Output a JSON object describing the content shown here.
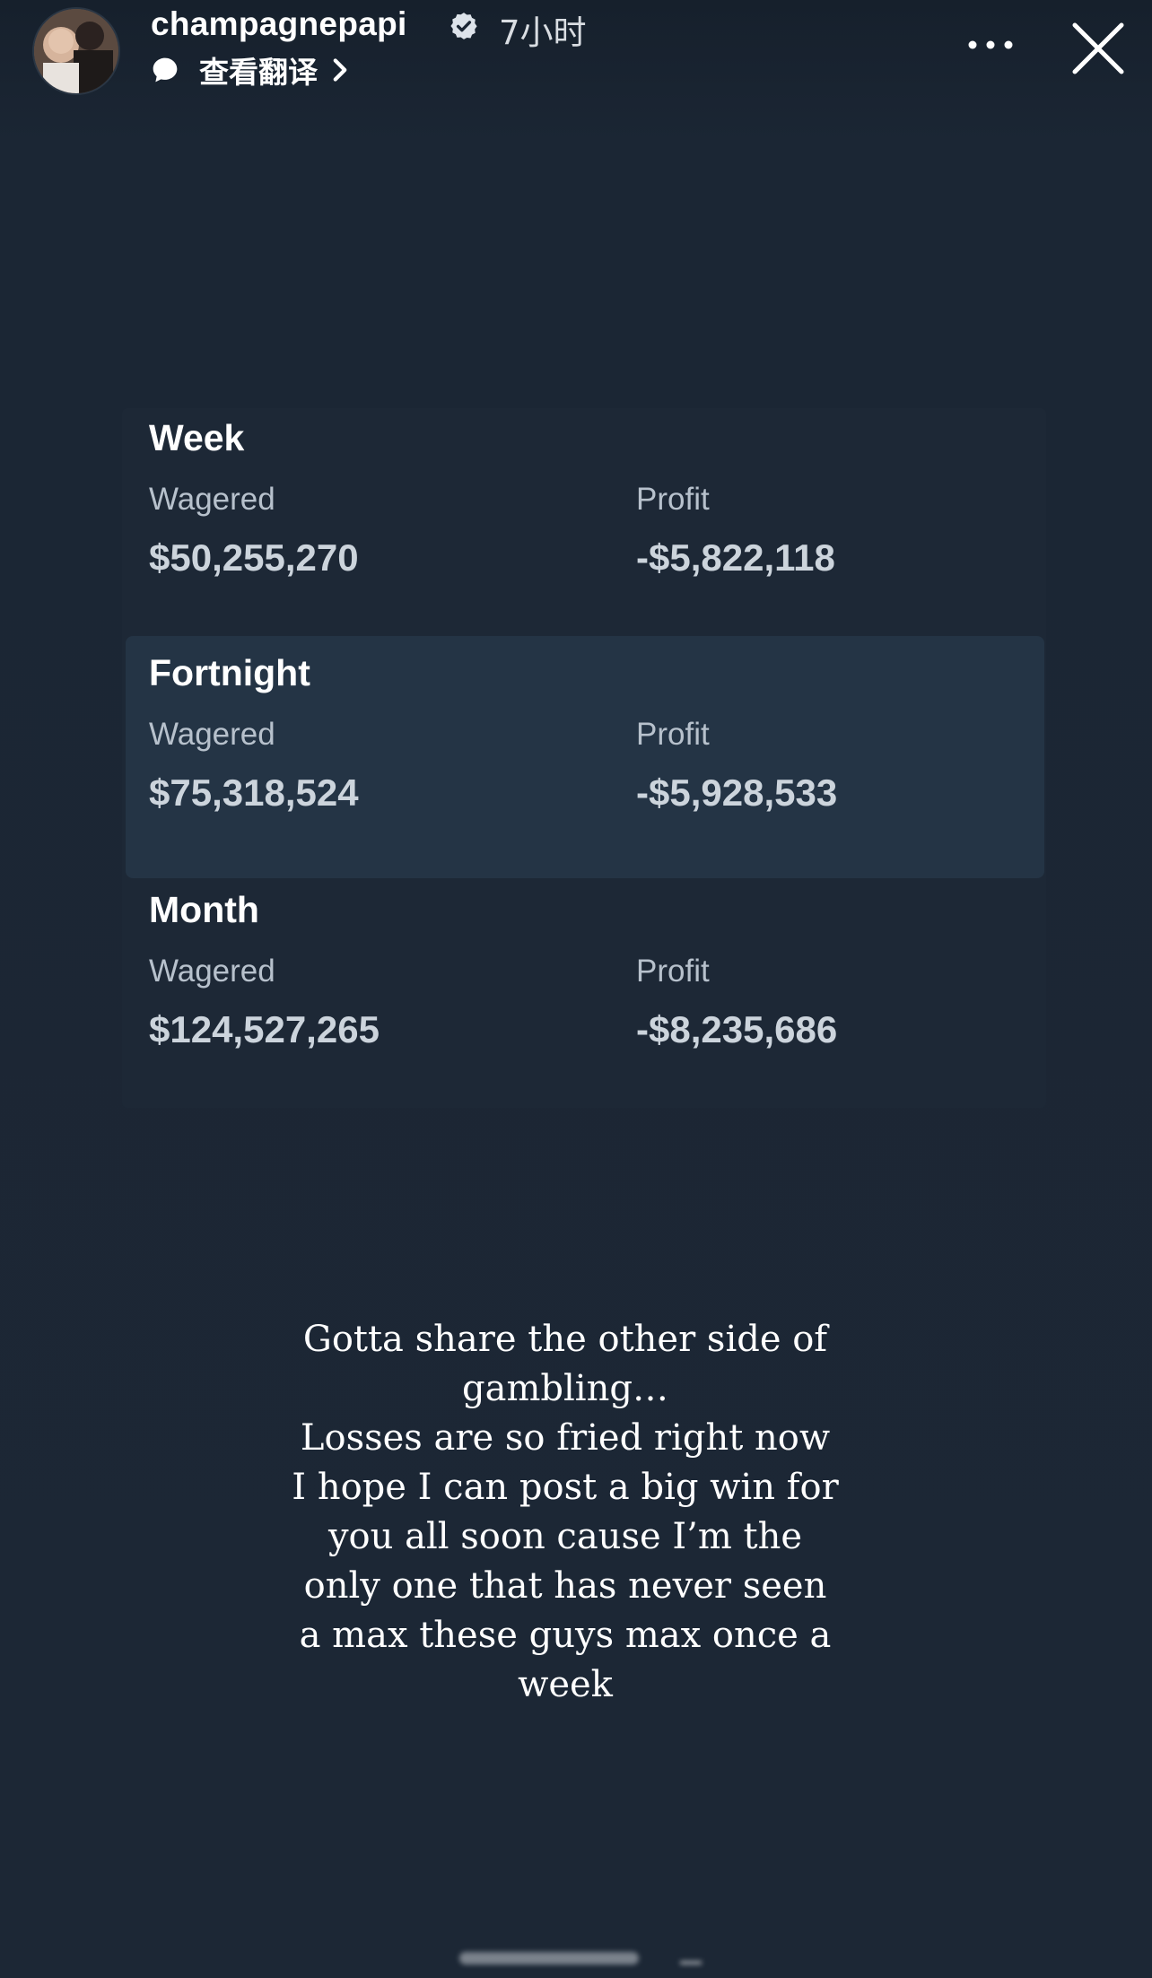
{
  "header": {
    "username": "champagnepapi",
    "time": "7小时",
    "translate_label": "查看翻译",
    "icons": {
      "avatar": "profile-photo",
      "verified": "verified-badge-icon",
      "translate": "chat-bubble-icon",
      "chevron": "chevron-right-icon",
      "more": "more-horizontal-icon",
      "close": "close-icon"
    }
  },
  "stats": [
    {
      "period": "Week",
      "wagered_label": "Wagered",
      "wagered": "$50,255,270",
      "profit_label": "Profit",
      "profit": "-$5,822,118",
      "highlighted": false
    },
    {
      "period": "Fortnight",
      "wagered_label": "Wagered",
      "wagered": "$75,318,524",
      "profit_label": "Profit",
      "profit": "-$5,928,533",
      "highlighted": true
    },
    {
      "period": "Month",
      "wagered_label": "Wagered",
      "wagered": "$124,527,265",
      "profit_label": "Profit",
      "profit": "-$8,235,686",
      "highlighted": false
    }
  ],
  "caption": {
    "lines": [
      "Gotta share the other side of",
      "gambling…",
      "Losses are so fried right now",
      "I hope I can post a big win for",
      "you all soon cause I’m the",
      "only one that has never seen",
      "a max these guys max once a",
      "week"
    ]
  },
  "colors": {
    "background": "#1b2634",
    "highlight_row": "#243445",
    "text_primary": "#ffffff",
    "text_label": "#b7c1cc"
  }
}
